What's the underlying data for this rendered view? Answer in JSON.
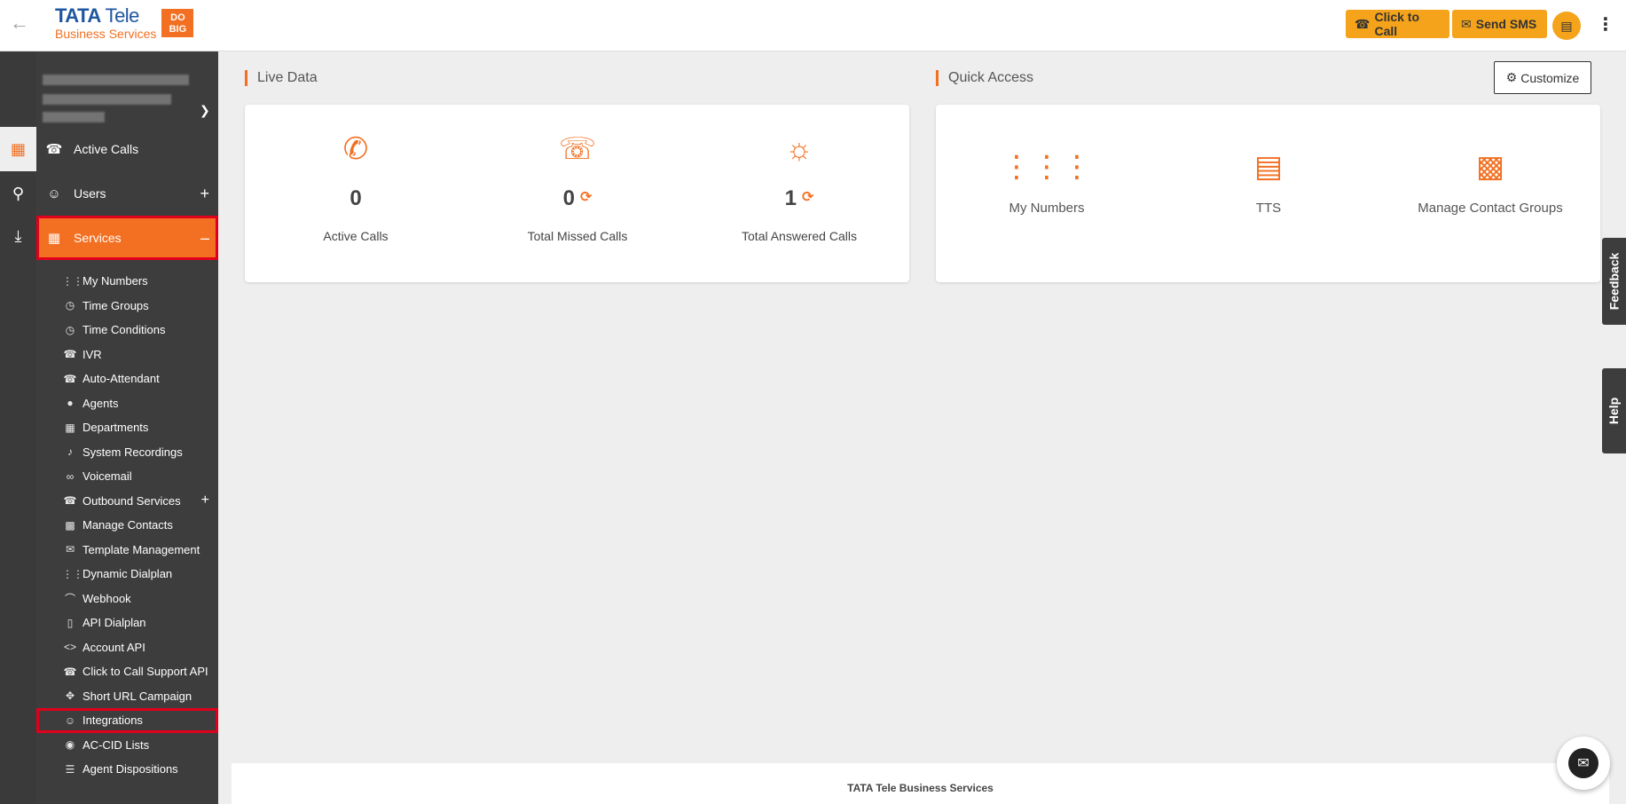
{
  "header": {
    "logo": {
      "brand": "TATA",
      "tele": "Tele",
      "subtitle": "Business Services",
      "badge_line1": "DO",
      "badge_line2": "BIG"
    },
    "click_to_call_label": "Click to Call",
    "send_sms_label": "Send SMS"
  },
  "sidebar": {
    "main": [
      {
        "label": "Active Calls",
        "icon": "phone-icon"
      },
      {
        "label": "Users",
        "icon": "users-icon"
      },
      {
        "label": "Services",
        "icon": "grid-icon"
      }
    ],
    "sub_items": [
      {
        "label": "My Numbers",
        "icon": "dialpad-icon"
      },
      {
        "label": "Time Groups",
        "icon": "alarm-icon"
      },
      {
        "label": "Time Conditions",
        "icon": "alarm-icon"
      },
      {
        "label": "IVR",
        "icon": "phone-forward-icon"
      },
      {
        "label": "Auto-Attendant",
        "icon": "phone-forward-icon"
      },
      {
        "label": "Agents",
        "icon": "person-icon"
      },
      {
        "label": "Departments",
        "icon": "building-icon"
      },
      {
        "label": "System Recordings",
        "icon": "mic-icon"
      },
      {
        "label": "Voicemail",
        "icon": "voicemail-icon"
      },
      {
        "label": "Outbound Services",
        "icon": "outbound-icon"
      },
      {
        "label": "Manage Contacts",
        "icon": "contacts-icon"
      },
      {
        "label": "Template Management",
        "icon": "mail-icon"
      },
      {
        "label": "Dynamic Dialplan",
        "icon": "dialpad-icon"
      },
      {
        "label": "Webhook",
        "icon": "webhook-icon"
      },
      {
        "label": "API Dialplan",
        "icon": "mobile-icon"
      },
      {
        "label": "Account API",
        "icon": "code-icon"
      },
      {
        "label": "Click to Call Support API",
        "icon": "phone-icon"
      },
      {
        "label": "Short URL Campaign",
        "icon": "move-icon"
      },
      {
        "label": "Integrations",
        "icon": "group-icon"
      },
      {
        "label": "AC-CID Lists",
        "icon": "globe-icon"
      },
      {
        "label": "Agent Dispositions",
        "icon": "list-icon"
      }
    ]
  },
  "live_data": {
    "title": "Live Data",
    "stats": [
      {
        "value": "0",
        "label": "Active Calls"
      },
      {
        "value": "0",
        "label": "Total Missed Calls"
      },
      {
        "value": "1",
        "label": "Total Answered Calls"
      }
    ]
  },
  "quick_access": {
    "title": "Quick Access",
    "customize_label": "Customize",
    "items": [
      {
        "label": "My Numbers"
      },
      {
        "label": "TTS"
      },
      {
        "label": "Manage Contact Groups"
      }
    ]
  },
  "side_tabs": {
    "feedback": "Feedback",
    "help": "Help"
  },
  "footer": {
    "text": "TATA Tele Business Services"
  },
  "colors": {
    "accent": "#f36f21",
    "button": "#f5a31a",
    "sidebar": "#3d3d3d",
    "highlight": "#e0001b"
  }
}
